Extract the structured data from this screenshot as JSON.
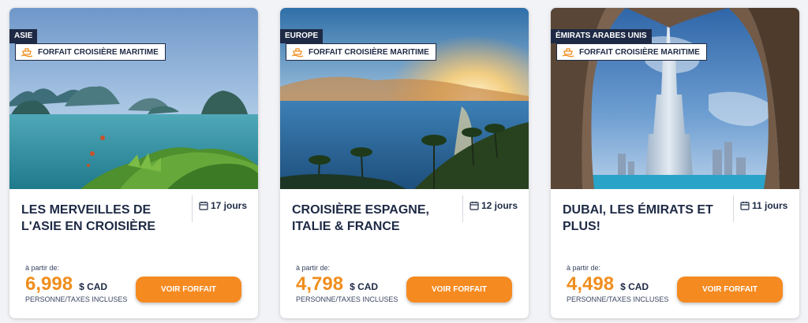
{
  "cards": [
    {
      "region": "ASIE",
      "type": "FORFAIT CROISIÈRE MARITIME",
      "title": "LES MERVEILLES DE L'ASIE EN CROISIÈRE",
      "duration": "17 jours",
      "from": "à partir de:",
      "price": "6,998",
      "currency": "$ CAD",
      "per_person": "PERSONNE/TAXES INCLUSES",
      "button": "VOIR FORFAIT"
    },
    {
      "region": "EUROPE",
      "type": "FORFAIT CROISIÈRE MARITIME",
      "title": "CROISIÈRE ESPAGNE, ITALIE & FRANCE",
      "duration": "12 jours",
      "from": "à partir de:",
      "price": "4,798",
      "currency": "$ CAD",
      "per_person": "PERSONNE/TAXES INCLUSES",
      "button": "VOIR FORFAIT"
    },
    {
      "region": "ÉMIRATS ARABES UNIS",
      "type": "FORFAIT CROISIÈRE MARITIME",
      "title": "DUBAI, LES ÉMIRATS ET PLUS!",
      "duration": "11 jours",
      "from": "à partir de:",
      "price": "4,498",
      "currency": "$ CAD",
      "per_person": "PERSONNE/TAXES INCLUSES",
      "button": "VOIR FORFAIT"
    }
  ],
  "colors": {
    "accent": "#f58a20",
    "price": "#f08e1e",
    "navy": "#1e2a45"
  },
  "icons": {
    "type_tag": "ship-icon",
    "duration": "calendar-icon"
  }
}
